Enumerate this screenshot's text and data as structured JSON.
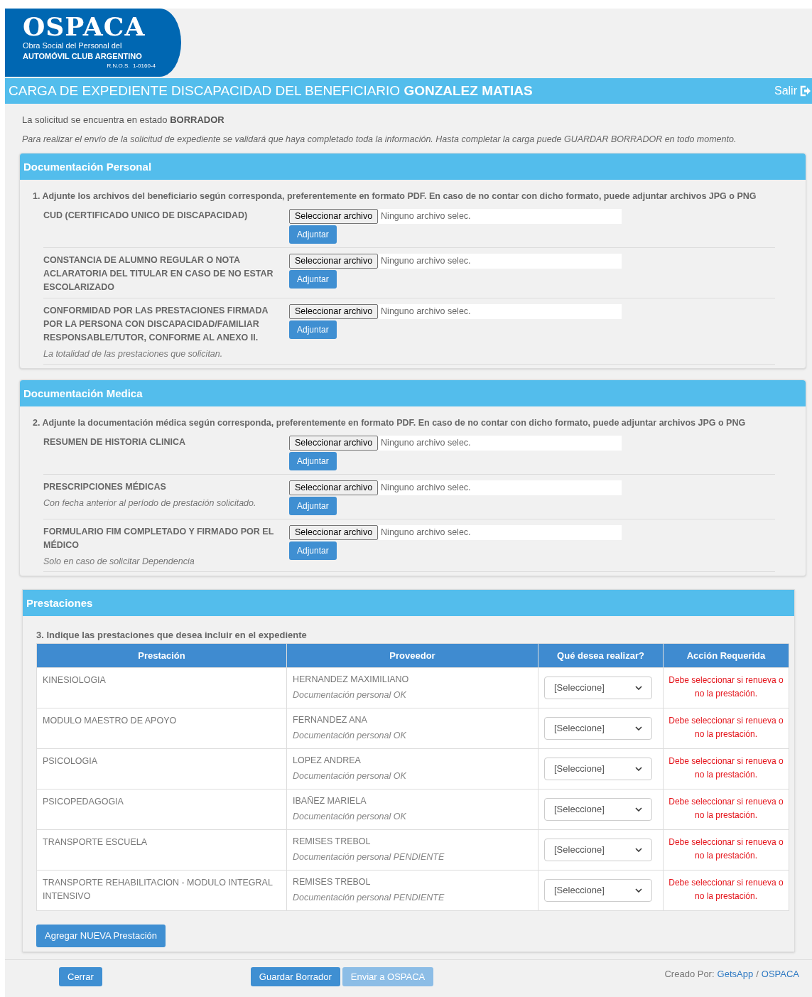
{
  "logo": {
    "name": "OSPACA",
    "line_1": "Obra Social del Personal del",
    "line_2": "AUTOMÓVIL CLUB ARGENTINO",
    "registry": "R.N.O.S.  1-0160-4"
  },
  "header": {
    "title": "CARGA DE EXPEDIENTE DISCAPACIDAD DEL BENEFICIARIO **GONZALEZ MATIAS**",
    "logout": "Salir"
  },
  "status": "La solicitud se encuentra en estado **BORRADOR**",
  "note": "Para realizar el envío de la solicitud de expediente se validará que haya completado toda la información. Hasta completar la carga puede GUARDAR BORRADOR en todo momento.",
  "doc_sections": [
    {
      "title": "Documentación Personal",
      "instruction": "1. Adjunte los archivos del beneficiario según corresponda, preferentemente en formato PDF. En caso de no contar con dicho formato, puede adjuntar archivos JPG o PNG",
      "items": [
        {
          "label": "CUD (CERTIFICADO UNICO DE DISCAPACIDAD)",
          "choose": "Seleccionar archivo",
          "file": "Ninguno archivo selec.",
          "attach": "Adjuntar"
        },
        {
          "label": "CONSTANCIA DE ALUMNO REGULAR O NOTA ACLARATORIA DEL TITULAR EN CASO DE NO ESTAR ESCOLARIZADO",
          "choose": "Seleccionar archivo",
          "file": "Ninguno archivo selec.",
          "attach": "Adjuntar"
        },
        {
          "label": "CONFORMIDAD POR LAS PRESTACIONES FIRMADA POR LA PERSONA CON DISCAPACIDAD/FAMILIAR RESPONSABLE/TUTOR, CONFORME AL ANEXO II.",
          "hint": "La totalidad de las prestaciones que solicitan.",
          "choose": "Seleccionar archivo",
          "file": "Ninguno archivo selec.",
          "attach": "Adjuntar"
        }
      ]
    },
    {
      "title": "Documentación Medica",
      "instruction": "2. Adjunte la documentación médica según corresponda, preferentemente en formato PDF. En caso de no contar con dicho formato, puede adjuntar archivos JPG o PNG",
      "items": [
        {
          "label": "RESUMEN DE HISTORIA CLINICA",
          "choose": "Seleccionar archivo",
          "file": "Ninguno archivo selec.",
          "attach": "Adjuntar"
        },
        {
          "label": "PRESCRIPCIONES MÉDICAS",
          "hint": "Con fecha anterior al período de prestación solicitado.",
          "choose": "Seleccionar archivo",
          "file": "Ninguno archivo selec.",
          "attach": "Adjuntar"
        },
        {
          "label": "FORMULARIO FIM COMPLETADO Y FIRMADO POR EL MÉDICO",
          "hint": "Solo en caso de solicitar Dependencia",
          "choose": "Seleccionar archivo",
          "file": "Ninguno archivo selec.",
          "attach": "Adjuntar"
        }
      ]
    }
  ],
  "services": {
    "title": "Prestaciones",
    "instruction": "3. Indique las prestaciones que desea incluir en el expediente",
    "columns": [
      "Prestación",
      "Proveedor",
      "Qué desea realizar?",
      "Acción Requerida"
    ],
    "rows": [
      {
        "service": "KINESIOLOGIA",
        "provider": "HERNANDEZ MAXIMILIANO",
        "doc_status": "Documentación personal OK",
        "select": "[Seleccione]",
        "action": "Debe seleccionar si renueva o no la prestación."
      },
      {
        "service": "MODULO MAESTRO DE APOYO",
        "provider": "FERNANDEZ ANA",
        "doc_status": "Documentación personal OK",
        "select": "[Seleccione]",
        "action": "Debe seleccionar si renueva o no la prestación."
      },
      {
        "service": "PSICOLOGIA",
        "provider": "LOPEZ ANDREA",
        "doc_status": "Documentación personal OK",
        "select": "[Seleccione]",
        "action": "Debe seleccionar si renueva o no la prestación."
      },
      {
        "service": "PSICOPEDAGOGIA",
        "provider": "IBAÑEZ MARIELA",
        "doc_status": "Documentación personal OK",
        "select": "[Seleccione]",
        "action": "Debe seleccionar si renueva o no la prestación."
      },
      {
        "service": "TRANSPORTE ESCUELA",
        "provider": "REMISES TREBOL",
        "doc_status": "Documentación personal PENDIENTE",
        "select": "[Seleccione]",
        "action": "Debe seleccionar si renueva o no la prestación."
      },
      {
        "service": "TRANSPORTE REHABILITACION - MODULO INTEGRAL INTENSIVO",
        "provider": "REMISES TREBOL",
        "doc_status": "Documentación personal PENDIENTE",
        "select": "[Seleccione]",
        "action": "Debe seleccionar si renueva o no la prestación."
      }
    ],
    "add_button": "Agregar NUEVA Prestación"
  },
  "footer": {
    "buttons": [
      {
        "label": "Cerrar",
        "disabled": false
      },
      {
        "label": "Guardar Borrador",
        "disabled": false
      },
      {
        "label": "Enviar a OSPACA",
        "disabled": true
      }
    ],
    "credit": "Creado Por:",
    "links": [
      "GetsApp",
      "OSPACA"
    ],
    "separator": "/"
  }
}
